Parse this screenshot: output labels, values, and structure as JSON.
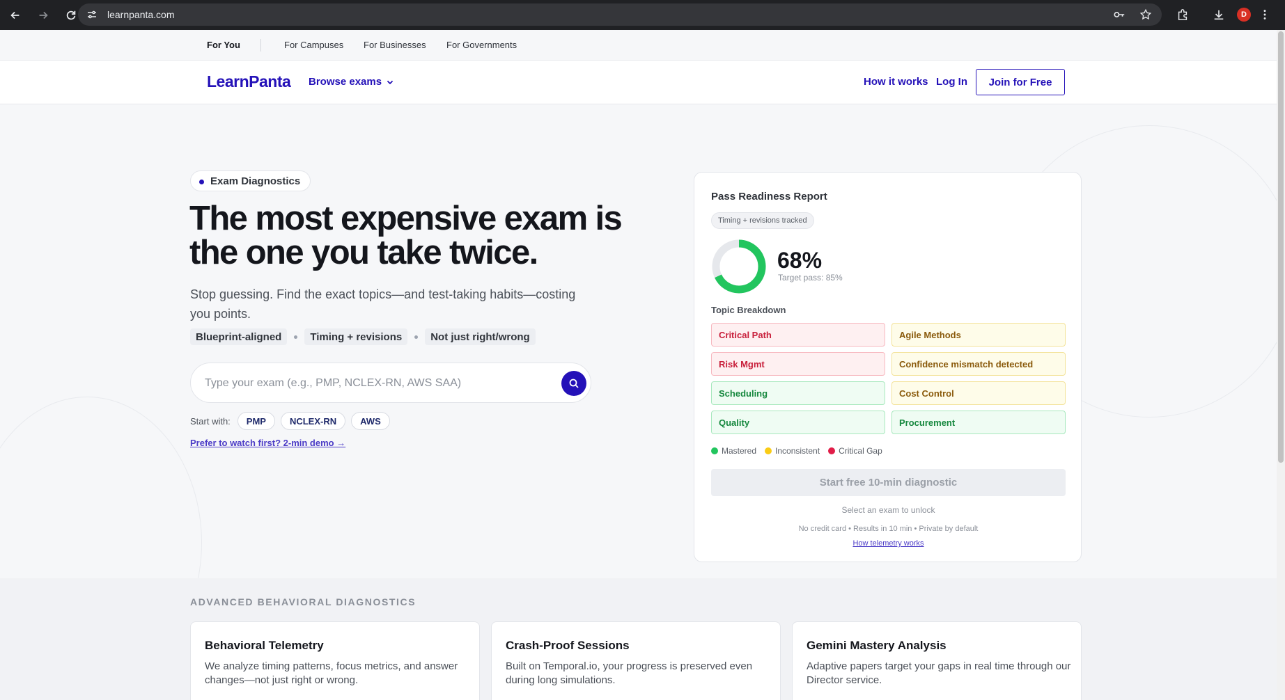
{
  "browser": {
    "url": "learnpanta.com",
    "profile_initial": "D"
  },
  "audience_nav": {
    "items": [
      "For You",
      "For Campuses",
      "For Businesses",
      "For Governments"
    ]
  },
  "header": {
    "logo": "LearnPanta",
    "browse": "Browse exams",
    "how_it_works": "How it works",
    "login": "Log In",
    "join": "Join for Free"
  },
  "hero": {
    "tag": "Exam Diagnostics",
    "headline": "The most expensive exam is the one you take twice.",
    "subline": "Stop guessing. Find the exact topics—and test-taking habits—costing you points.",
    "chips": [
      "Blueprint-aligned",
      "Timing + revisions",
      "Not just right/wrong"
    ],
    "search_placeholder": "Type your exam (e.g., PMP, NCLEX-RN, AWS SAA)",
    "search_value": "",
    "start_with_label": "Start with:",
    "quick_exams": [
      "PMP",
      "NCLEX-RN",
      "AWS"
    ],
    "demo_link": "Prefer to watch first? 2-min demo →"
  },
  "report": {
    "title": "Pass Readiness Report",
    "tracked_badge": "Timing + revisions tracked",
    "score": "68%",
    "score_fraction": 0.68,
    "target": "Target pass: 85%",
    "topic_label": "Topic Breakdown",
    "topics": [
      {
        "name": "Critical Path",
        "status": "gap"
      },
      {
        "name": "Agile Methods",
        "status": "inconsistent"
      },
      {
        "name": "Risk Mgmt",
        "status": "gap"
      },
      {
        "name": "Confidence mismatch detected",
        "status": "inconsistent"
      },
      {
        "name": "Scheduling",
        "status": "mastered"
      },
      {
        "name": "Cost Control",
        "status": "inconsistent"
      },
      {
        "name": "Quality",
        "status": "mastered"
      },
      {
        "name": "Procurement",
        "status": "mastered"
      }
    ],
    "legend": {
      "mastered": "Mastered",
      "inconsistent": "Inconsistent",
      "gap": "Critical Gap"
    },
    "colors": {
      "mastered": "#22c55e",
      "inconsistent": "#facc15",
      "gap": "#e11d48",
      "accent": "#2411b8"
    },
    "cta": "Start free 10-min diagnostic",
    "unlock_note": "Select an exam to unlock",
    "fine_print": "No credit card • Results in 10 min • Private by default",
    "telemetry_link": "How telemetry works"
  },
  "features": {
    "section_title": "ADVANCED BEHAVIORAL DIAGNOSTICS",
    "cards": [
      {
        "title": "Behavioral Telemetry",
        "desc": "We analyze timing patterns, focus metrics, and answer changes—not just right or wrong."
      },
      {
        "title": "Crash-Proof Sessions",
        "desc": "Built on Temporal.io, your progress is preserved even during long simulations."
      },
      {
        "title": "Gemini Mastery Analysis",
        "desc": "Adaptive papers target your gaps in real time through our Director service."
      }
    ]
  }
}
